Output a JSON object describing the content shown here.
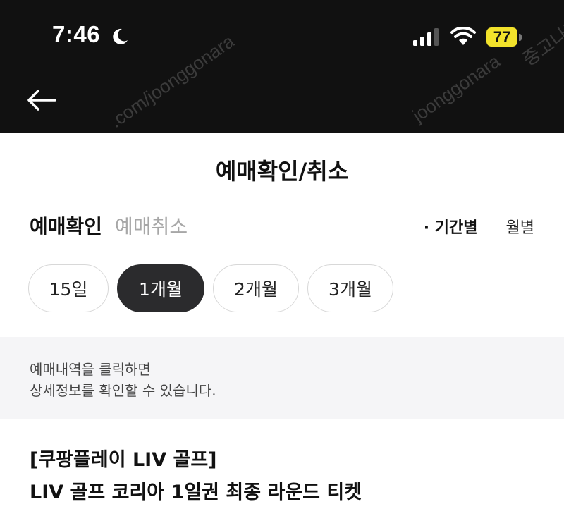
{
  "status_bar": {
    "time": "7:46",
    "battery_level": "77",
    "battery_color": "#f2e22b",
    "icons": [
      "moon-icon",
      "signal-icon",
      "wifi-icon",
      "battery-icon"
    ]
  },
  "header": {
    "back_icon": "arrow-left-icon",
    "title": "예매확인/취소"
  },
  "tabs": [
    {
      "label": "예매확인",
      "active": true
    },
    {
      "label": "예매취소",
      "active": false
    }
  ],
  "view_modes": [
    {
      "label": "· 기간별",
      "active": true
    },
    {
      "label": "월별",
      "active": false
    }
  ],
  "periods": [
    {
      "label": "15일",
      "selected": false
    },
    {
      "label": "1개월",
      "selected": true
    },
    {
      "label": "2개월",
      "selected": false
    },
    {
      "label": "3개월",
      "selected": false
    }
  ],
  "info": {
    "line1": "예매내역을 클릭하면",
    "line2": "상세정보를 확인할 수 있습니다."
  },
  "event": {
    "category": "[쿠팡플레이 LIV 골프]",
    "title": "LIV 골프 코리아 1일권 최종 라운드 티켓"
  },
  "watermarks": {
    "site": "joonggonara",
    "site_domain": ".com/joonggonara",
    "text": "중고나라"
  },
  "colors": {
    "header_bg": "#111111",
    "selected_period_bg": "#2b2b2d",
    "info_bg": "#f5f5f7",
    "inactive_tab": "#a7a7a7"
  }
}
